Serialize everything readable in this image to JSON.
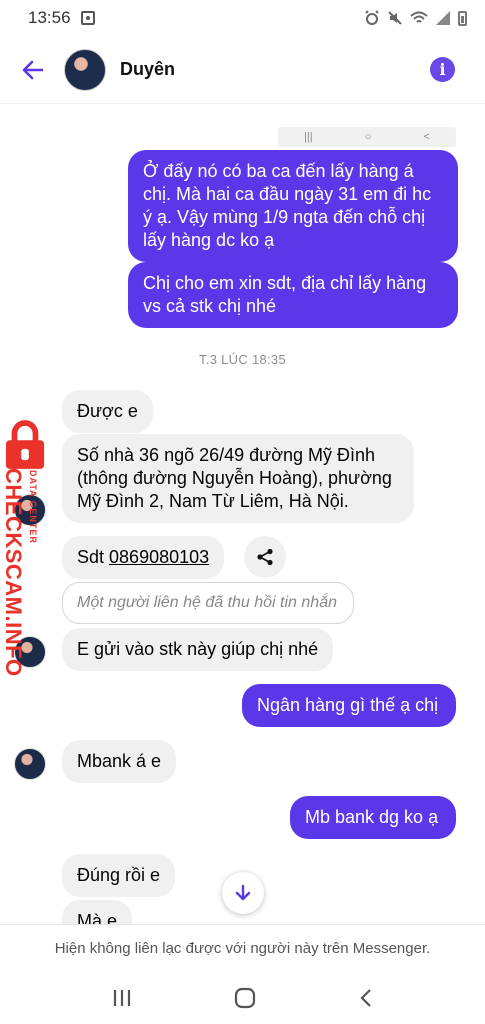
{
  "status_bar": {
    "time": "13:56"
  },
  "header": {
    "contact_name": "Duyên"
  },
  "colors": {
    "accent": "#5b37ea",
    "incoming_bubble": "#f0f0f0",
    "watermark": "#e8322a"
  },
  "messages": {
    "out1": "Ở đấy nó có ba ca đến lấy hàng á chị. Mà hai ca đầu ngày 31 em đi hc ý ạ. Vậy mùng 1/9 ngta đến chỗ chị lấy hàng dc ko ạ",
    "out2": "Chị cho em xin sdt, địa chỉ lấy hàng vs cả stk chị nhé",
    "timestamp": "T.3 LÚC 18:35",
    "in1": "Được e",
    "in2": "Số nhà 36 ngõ 26/49 đường Mỹ Đình (thông đường Nguyễn Hoàng), phường Mỹ Đình 2, Nam Từ Liêm, Hà Nội.",
    "in3_prefix": "Sdt ",
    "in3_phone": "0869080103",
    "unsent_notice": "Một người liên hệ đã thu hồi tin nhắn",
    "in4": "E gửi vào stk này giúp chị nhé",
    "out3": "Ngân hàng gì thế ạ chị",
    "in5": "Mbank á e",
    "out4": "Mb bank dg ko ạ",
    "in6": "Đúng rồi e",
    "in7": "Mà e"
  },
  "watermark": {
    "main": "CHECKSCAM.INFO",
    "sub": "DATA CENTER"
  },
  "footer": {
    "notice": "Hiện không liên lạc được với người này trên Messenger."
  }
}
